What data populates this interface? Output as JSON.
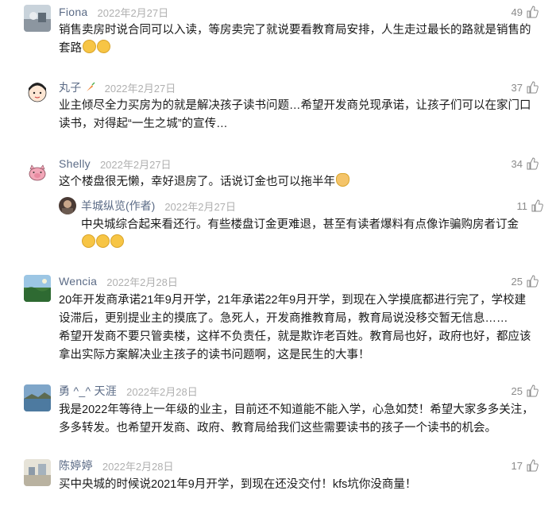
{
  "comments": [
    {
      "name": "Fiona",
      "date": "2022年2月27日",
      "likes": "49",
      "text": "销售卖房时说合同可以入读，等房卖完了就说要看教育局安排，人生走过最长的路就是销售的套路",
      "emojis": [
        "awkward-emoji",
        "awkward-emoji"
      ]
    },
    {
      "name": "丸子",
      "date": "2022年2月27日",
      "likes": "37",
      "text": "业主倾尽全力买房为的就是解决孩子读书问题…希望开发商兑现承诺，让孩子们可以在家门口读书，对得起“一生之城”的宣传…"
    },
    {
      "name": "Shelly",
      "date": "2022年2月27日",
      "likes": "34",
      "text": "这个楼盘很无懒，幸好退房了。话说订金也可以拖半年",
      "reply": {
        "name": "羊城纵览(作者)",
        "date": "2022年2月27日",
        "likes": "11",
        "text": "中央城综合起来看还行。有些楼盘订金更难退，甚至有读者爆料有点像诈骗购房者订金"
      }
    },
    {
      "name": "Wencia",
      "date": "2022年2月28日",
      "likes": "25",
      "text": "20年开发商承诺21年9月开学，21年承诺22年9月开学，到现在入学摸底都进行完了，学校建设滞后，更别提业主的摸底了。急死人，开发商推教育局，教育局说没移交暂无信息……\n希望开发商不要只管卖楼，这样不负责任，就是欺诈老百姓。教育局也好，政府也好，都应该拿出实际方案解决业主孩子的读书问题啊，这是民生的大事！"
    },
    {
      "name": "勇 ^_^ 天涯",
      "date": "2022年2月28日",
      "likes": "25",
      "text": "我是2022年等待上一年级的业主，目前还不知道能不能入学，心急如焚！希望大家多多关注，多多转发。也希望开发商、政府、教育局给我们这些需要读书的孩子一个读书的机会。"
    },
    {
      "name": "陈婷婷",
      "date": "2022年2月28日",
      "likes": "17",
      "text": "买中央城的时候说2021年9月开学，到现在还没交付！kfs坑你没商量！"
    }
  ],
  "colors": {
    "name": "#5b6b86",
    "date": "#b0b0b0",
    "likes": "#8a8a8a",
    "text": "#1a1a1a"
  }
}
